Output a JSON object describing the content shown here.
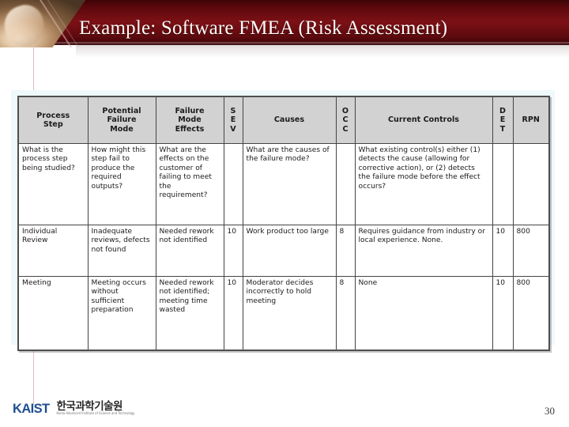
{
  "slide": {
    "title": "Example: Software FMEA (Risk Assessment)",
    "page_number": "30",
    "banner_color": "#5b080c",
    "title_color": "#fdfbf8",
    "figure_frame_color": "#eff8fa"
  },
  "footer": {
    "logo_word": "KAIST",
    "logo_korean": "한국과학기술원",
    "logo_english": "Korea Advanced Institute of Science and Technology",
    "logo_color": "#1f4f8f"
  },
  "fmea_table": {
    "headers": [
      "Process\nStep",
      "Potential\nFailure\nMode",
      "Failure\nMode\nEffects",
      "S\nE\nV",
      "Causes",
      "O\nC\nC",
      "Current Controls",
      "D\nE\nT",
      "RPN"
    ],
    "headers_flat": [
      "Process Step",
      "Potential Failure Mode",
      "Failure Mode Effects",
      "SEV",
      "Causes",
      "OCC",
      "Current Controls",
      "DET",
      "RPN"
    ],
    "rows": [
      {
        "type": "description",
        "process_step": "What is the process step being studied?",
        "potential_failure_mode": "How might this step fail to produce the required outputs?",
        "failure_mode_effects": "What are the effects on the customer of failing to meet the requirement?",
        "sev": "",
        "causes": "What are the causes of the failure mode?",
        "occ": "",
        "current_controls": "What existing control(s) either (1) detects the cause (allowing for corrective action), or (2) detects the failure mode before the effect occurs?",
        "det": "",
        "rpn": ""
      },
      {
        "type": "data",
        "process_step": "Individual Review",
        "potential_failure_mode": "Inadequate reviews, defects not found",
        "failure_mode_effects": "Needed rework not identified",
        "sev": "10",
        "causes": "Work product too large",
        "occ": "8",
        "current_controls": "Requires guidance from industry or local experience. None.",
        "det": "10",
        "rpn": "800"
      },
      {
        "type": "data",
        "process_step": "Meeting",
        "potential_failure_mode": "Meeting occurs without sufficient preparation",
        "failure_mode_effects": "Needed rework not identified; meeting time wasted",
        "sev": "10",
        "causes": "Moderator decides incorrectly to hold meeting",
        "occ": "8",
        "current_controls": "None",
        "det": "10",
        "rpn": "800"
      }
    ]
  }
}
